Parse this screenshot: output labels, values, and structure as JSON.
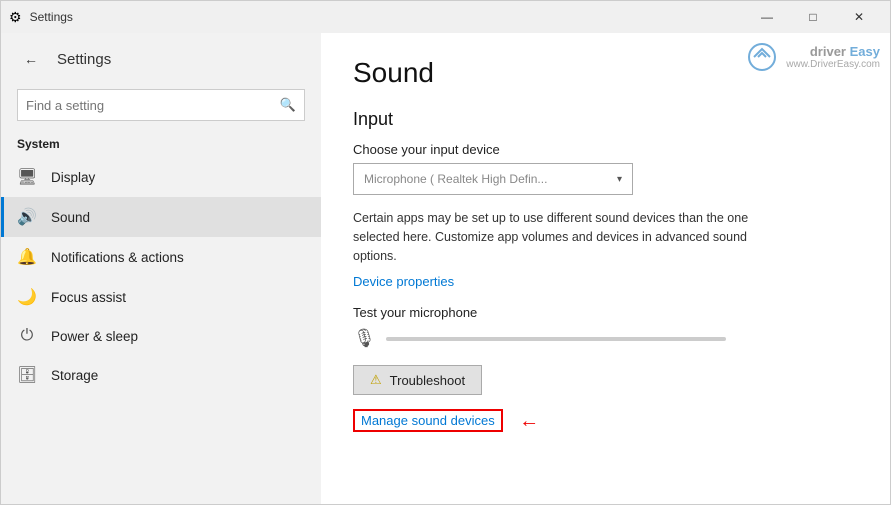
{
  "window": {
    "title": "Settings",
    "controls": {
      "minimize": "—",
      "maximize": "□",
      "close": "✕"
    }
  },
  "sidebar": {
    "back_label": "←",
    "app_title": "Settings",
    "search": {
      "placeholder": "Find a setting",
      "icon": "🔍"
    },
    "section_title": "System",
    "nav_items": [
      {
        "id": "display",
        "icon": "🖥",
        "label": "Display"
      },
      {
        "id": "sound",
        "icon": "🔊",
        "label": "Sound",
        "active": true
      },
      {
        "id": "notifications",
        "icon": "🔔",
        "label": "Notifications & actions"
      },
      {
        "id": "focus",
        "icon": "🌙",
        "label": "Focus assist"
      },
      {
        "id": "power",
        "icon": "⏻",
        "label": "Power & sleep"
      },
      {
        "id": "storage",
        "icon": "🗄",
        "label": "Storage"
      }
    ]
  },
  "main": {
    "page_title": "Sound",
    "section_title": "Input",
    "input_device_label": "Choose your input device",
    "input_device_value": "Microphone ( Realtek High Defin...",
    "description": "Certain apps may be set up to use different sound devices than the one selected here. Customize app volumes and devices in advanced sound options.",
    "device_properties_link": "Device properties",
    "test_label": "Test your microphone",
    "troubleshoot_label": "Troubleshoot",
    "manage_label": "Manage sound devices",
    "warn_icon": "⚠"
  },
  "watermark": {
    "brand": "driver Easy",
    "url": "www.DriverEasy.com"
  }
}
